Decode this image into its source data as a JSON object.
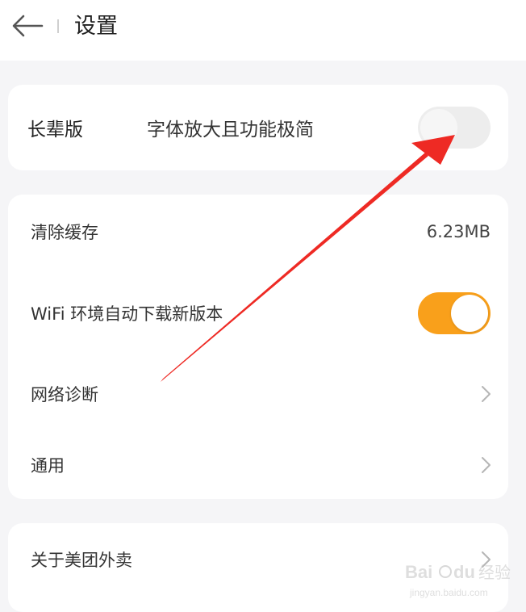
{
  "header": {
    "title": "设置",
    "back_icon": "arrow-left-icon"
  },
  "elder_mode": {
    "label": "长辈版",
    "subtitle": "字体放大且功能极简",
    "enabled": false
  },
  "settings": {
    "clear_cache": {
      "label": "清除缓存",
      "value": "6.23MB"
    },
    "wifi_auto_download": {
      "label": "WiFi 环境自动下载新版本",
      "enabled": true
    },
    "network_diagnosis": {
      "label": "网络诊断",
      "icon": "chevron-right-icon"
    },
    "general": {
      "label": "通用",
      "icon": "chevron-right-icon"
    }
  },
  "about": {
    "label": "关于美团外卖",
    "icon": "chevron-right-icon"
  },
  "colors": {
    "toggle_on": "#f9a01b",
    "toggle_off": "#ededed",
    "annotation_arrow": "#ee2a24",
    "background": "#f5f5f7"
  }
}
